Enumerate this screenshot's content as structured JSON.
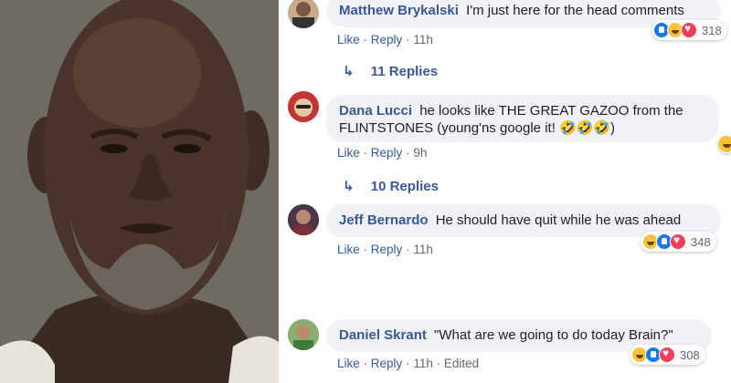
{
  "photo": {
    "alt": "mugshot"
  },
  "comments": [
    {
      "author": "Matthew Brykalski",
      "text": "I'm just here for the head comments",
      "like": "Like",
      "reply": "Reply",
      "sep": "·",
      "time": "11h",
      "reaction_count": "318",
      "replies": "11 Replies"
    },
    {
      "author": "Dana Lucci",
      "text": "he looks like THE GREAT GAZOO from the",
      "text2": "FLINTSTONES (young'ns google it! 🤣🤣🤣)",
      "like": "Like",
      "reply": "Reply",
      "sep": "·",
      "time": "9h",
      "replies": "10 Replies"
    },
    {
      "author": "Jeff Bernardo",
      "text": "He should have quit while he was ahead",
      "like": "Like",
      "reply": "Reply",
      "sep": "·",
      "time": "11h",
      "reaction_count": "348"
    },
    {
      "author": "Daniel Skrant",
      "text": "\"What are we going to do today Brain?\"",
      "like": "Like",
      "reply": "Reply",
      "sep": "·",
      "time": "11h",
      "edited": "Edited",
      "reaction_count": "308"
    }
  ],
  "colors": {
    "link": "#385898",
    "bubble": "#f0f2f5",
    "like": "#1877f2",
    "haha": "#f7c33c",
    "love": "#f33e58"
  }
}
